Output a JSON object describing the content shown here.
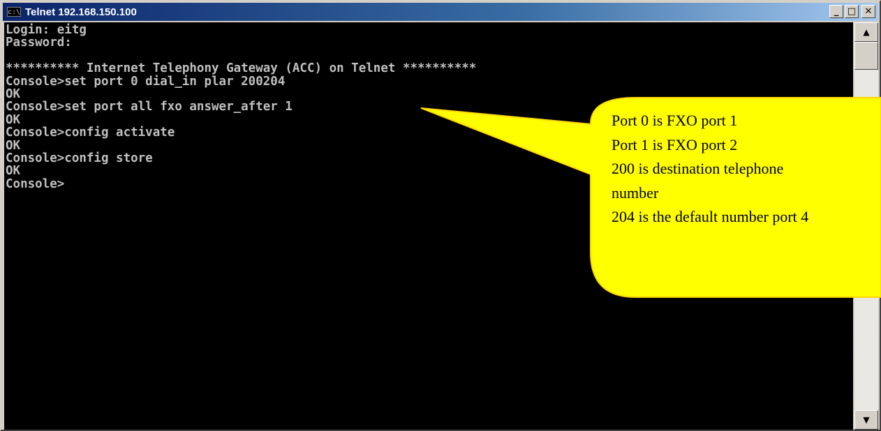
{
  "window": {
    "title": "Telnet 192.168.150.100",
    "icon": "c:\\",
    "controls": {
      "minimize": "_",
      "maximize": "□",
      "close": "✕"
    }
  },
  "console": {
    "lines": [
      "Login: eitg",
      "Password:",
      "",
      "********** Internet Telephony Gateway (ACC) on Telnet **********",
      "Console>set port 0 dial_in plar 200204",
      "OK",
      "Console>set port all fxo answer_after 1",
      "OK",
      "Console>config activate",
      "OK",
      "Console>config store",
      "OK",
      "Console>"
    ]
  },
  "scrollbar": {
    "up_arrow": "▲",
    "down_arrow": "▼"
  },
  "callout": {
    "fill": "#ffff00",
    "lines": [
      "Port 0 is FXO port 1",
      "Port 1 is FXO port 2",
      "200 is destination telephone",
      "number",
      "204 is the default number port 4"
    ]
  }
}
